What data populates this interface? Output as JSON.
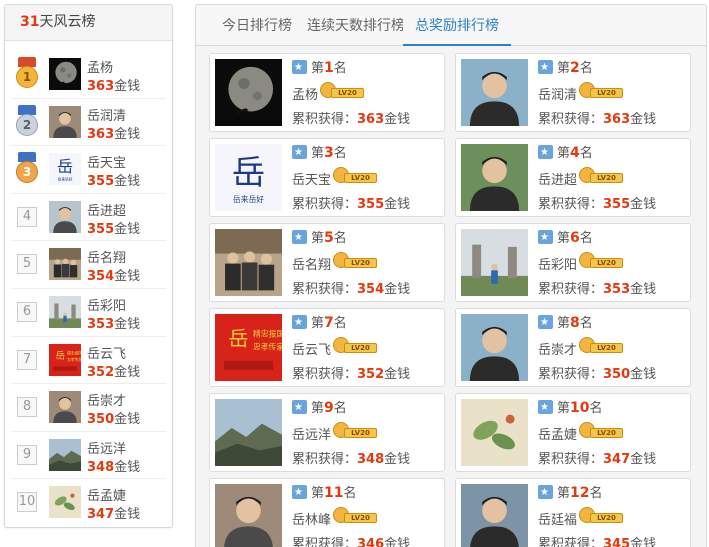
{
  "left_panel": {
    "header_count": "31",
    "header_title": "天风云榜",
    "items": [
      {
        "rank": "1",
        "name": "孟杨",
        "amount": "363",
        "unit": "金钱",
        "avatar": "moon-photo"
      },
      {
        "rank": "2",
        "name": "岳润清",
        "amount": "363",
        "unit": "金钱",
        "avatar": "person-photo"
      },
      {
        "rank": "3",
        "name": "岳天宝",
        "amount": "355",
        "unit": "金钱",
        "avatar": "calligraphy-photo"
      },
      {
        "rank": "4",
        "name": "岳进超",
        "amount": "355",
        "unit": "金钱",
        "avatar": "person-photo"
      },
      {
        "rank": "5",
        "name": "岳名翔",
        "amount": "354",
        "unit": "金钱",
        "avatar": "group-photo"
      },
      {
        "rank": "6",
        "name": "岳彩阳",
        "amount": "353",
        "unit": "金钱",
        "avatar": "monument-photo"
      },
      {
        "rank": "7",
        "name": "岳云飞",
        "amount": "352",
        "unit": "金钱",
        "avatar": "red-banner-photo"
      },
      {
        "rank": "8",
        "name": "岳崇才",
        "amount": "350",
        "unit": "金钱",
        "avatar": "person-photo"
      },
      {
        "rank": "9",
        "name": "岳远洋",
        "amount": "348",
        "unit": "金钱",
        "avatar": "landscape-photo"
      },
      {
        "rank": "10",
        "name": "岳孟婕",
        "amount": "347",
        "unit": "金钱",
        "avatar": "painting-photo"
      }
    ]
  },
  "tabs": [
    {
      "label": "今日排行榜",
      "active": false
    },
    {
      "label": "连续天数排行榜",
      "active": false
    },
    {
      "label": "总奖励排行榜",
      "active": true
    }
  ],
  "cards": [
    {
      "rank_prefix": "第",
      "rank": "1",
      "rank_suffix": "名",
      "name": "孟杨",
      "level": "LV20",
      "total_label": "累积获得：",
      "amount": "363",
      "unit": "金钱"
    },
    {
      "rank_prefix": "第",
      "rank": "2",
      "rank_suffix": "名",
      "name": "岳润清",
      "level": "LV20",
      "total_label": "累积获得：",
      "amount": "363",
      "unit": "金钱"
    },
    {
      "rank_prefix": "第",
      "rank": "3",
      "rank_suffix": "名",
      "name": "岳天宝",
      "level": "LV20",
      "total_label": "累积获得：",
      "amount": "355",
      "unit": "金钱"
    },
    {
      "rank_prefix": "第",
      "rank": "4",
      "rank_suffix": "名",
      "name": "岳进超",
      "level": "LV20",
      "total_label": "累积获得：",
      "amount": "355",
      "unit": "金钱"
    },
    {
      "rank_prefix": "第",
      "rank": "5",
      "rank_suffix": "名",
      "name": "岳名翔",
      "level": "LV20",
      "total_label": "累积获得：",
      "amount": "354",
      "unit": "金钱"
    },
    {
      "rank_prefix": "第",
      "rank": "6",
      "rank_suffix": "名",
      "name": "岳彩阳",
      "level": "LV20",
      "total_label": "累积获得：",
      "amount": "353",
      "unit": "金钱"
    },
    {
      "rank_prefix": "第",
      "rank": "7",
      "rank_suffix": "名",
      "name": "岳云飞",
      "level": "LV20",
      "total_label": "累积获得：",
      "amount": "352",
      "unit": "金钱"
    },
    {
      "rank_prefix": "第",
      "rank": "8",
      "rank_suffix": "名",
      "name": "岳崇才",
      "level": "LV20",
      "total_label": "累积获得：",
      "amount": "350",
      "unit": "金钱"
    },
    {
      "rank_prefix": "第",
      "rank": "9",
      "rank_suffix": "名",
      "name": "岳远洋",
      "level": "LV20",
      "total_label": "累积获得：",
      "amount": "348",
      "unit": "金钱"
    },
    {
      "rank_prefix": "第",
      "rank": "10",
      "rank_suffix": "名",
      "name": "岳孟婕",
      "level": "LV20",
      "total_label": "累积获得：",
      "amount": "347",
      "unit": "金钱"
    },
    {
      "rank_prefix": "第",
      "rank": "11",
      "rank_suffix": "名",
      "name": "岳林峰",
      "level": "LV20",
      "total_label": "累积获得：",
      "amount": "346",
      "unit": "金钱"
    },
    {
      "rank_prefix": "第",
      "rank": "12",
      "rank_suffix": "名",
      "name": "岳廷福",
      "level": "LV20",
      "total_label": "累积获得：",
      "amount": "345",
      "unit": "金钱"
    }
  ],
  "colors": {
    "accent_red": "#e4390f",
    "tab_active": "#2d82c8"
  }
}
